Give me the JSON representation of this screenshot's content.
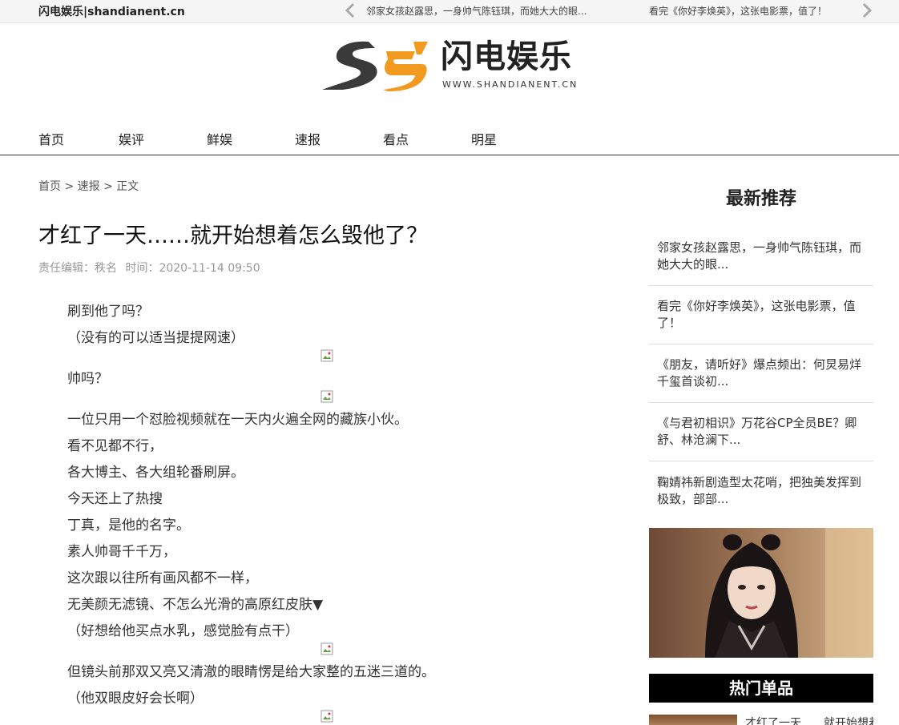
{
  "topbar": {
    "site_name": "闪电娱乐|shandianent.cn",
    "ticker": [
      "邻家女孩赵露思，一身帅气陈钰琪，而她大大的眼...",
      "看完《你好李焕英》，这张电影票，值了！"
    ]
  },
  "logo": {
    "cn": "闪电娱乐",
    "url": "WWW.SHANDIANENT.CN",
    "colors": {
      "dark": "#3a3a3a",
      "accent": "#f29a1f"
    }
  },
  "nav": [
    "首页",
    "娱评",
    "鲜娱",
    "速报",
    "看点",
    "明星"
  ],
  "breadcrumb": {
    "home": "首页",
    "sep": " > ",
    "section": "速报",
    "current": "正文"
  },
  "article": {
    "title": "才红了一天……就开始想着怎么毁他了？",
    "editor": "责任编辑：秩名",
    "time": "时间：2020-11-14 09:50",
    "paragraphs": [
      "刷到他了吗？",
      "（没有的可以适当提提网速）",
      "帅吗？",
      "一位只用一个怼脸视频就在一天内火遍全网的藏族小伙。",
      "看不见都不行，",
      "各大博主、各大组轮番刷屏。",
      "今天还上了热搜",
      "丁真，是他的名字。",
      "素人帅哥千千万，",
      "这次跟以往所有画风都不一样，",
      "无美颜无滤镜、不怎么光滑的高原红皮肤▼",
      "（好想给他买点水乳，感觉脸有点干）",
      "但镜头前那双又亮又清澈的眼睛愣是给大家整的五迷三道的。",
      "（他双眼皮好会长啊）"
    ]
  },
  "sidebar": {
    "title": "最新推荐",
    "items": [
      "邻家女孩赵露思，一身帅气陈钰琪，而她大大的眼...",
      "看完《你好李焕英》，这张电影票，值了！",
      "《朋友，请听好》爆点频出：何炅易烊千玺首谈初...",
      "《与君初相识》万花谷CP全员BE？卿舒、林沧澜下...",
      "鞠婧祎新剧造型太花哨，把独美发挥到极致，部部..."
    ],
    "hot_title": "热门单品",
    "hot_first": "才红了一天……就开始想着怎么毁他了？"
  }
}
